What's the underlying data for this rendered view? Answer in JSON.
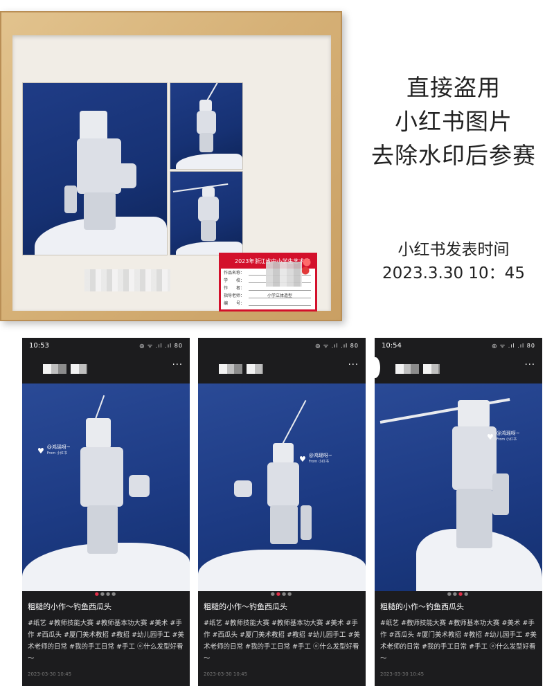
{
  "annotation": {
    "main_lines": [
      "直接盗用",
      "小红书图片",
      "去除水印后参赛"
    ],
    "publish_label": "小红书发表时间",
    "publish_time": "2023.3.30 10：45"
  },
  "framed_artwork": {
    "label_card": {
      "header": "2023年浙江省中小学生艺术节",
      "fields": [
        {
          "key": "作品名称：",
          "value": ""
        },
        {
          "key": "学　　校：",
          "value": ""
        },
        {
          "key": "作　　者：",
          "value": ""
        },
        {
          "key": "指导老师：",
          "value": "小学立体造型"
        },
        {
          "key": "编　　号：",
          "value": ""
        }
      ]
    }
  },
  "phones": [
    {
      "time": "10:53",
      "status_icons": "◎ ᯤ .ıl .ıl 80",
      "more": "···",
      "watermark_name": "@鸿瑶呀~",
      "watermark_from": "From 小红书",
      "title": "粗糙的小作～钓鱼西瓜头",
      "tags": "#纸艺 #教师技能大赛 #教师基本功大赛 #美术 #手作 #西瓜头 #厦门美术教招 #教招 #幼儿园手工 #美术老师的日常 #我的手工日常 #手工 ⓔ什么发型好看～",
      "date": "2023-03-30 10:45"
    },
    {
      "time": "",
      "status_icons": "◎ ᯤ .ıl .ıl 80",
      "more": "···",
      "watermark_name": "@鸿瑶呀~",
      "watermark_from": "From 小红书",
      "title": "粗糙的小作～钓鱼西瓜头",
      "tags": "#纸艺 #教师技能大赛 #教师基本功大赛 #美术 #手作 #西瓜头 #厦门美术教招 #教招 #幼儿园手工 #美术老师的日常 #我的手工日常 #手工 ⓔ什么发型好看～",
      "date": "2023-03-30 10:45"
    },
    {
      "time": "10:54",
      "status_icons": "◎ ᯤ .ıl .ıl 80",
      "more": "···",
      "watermark_name": "@鸿瑶呀~",
      "watermark_from": "From 小红书",
      "title": "粗糙的小作～钓鱼西瓜头",
      "tags": "#纸艺 #教师技能大赛 #教师基本功大赛 #美术 #手作 #西瓜头 #厦门美术教招 #教招 #幼儿园手工 #美术老师的日常 #我的手工日常 #手工 ⓔ什么发型好看～",
      "date": "2023-03-30 10:45"
    }
  ]
}
